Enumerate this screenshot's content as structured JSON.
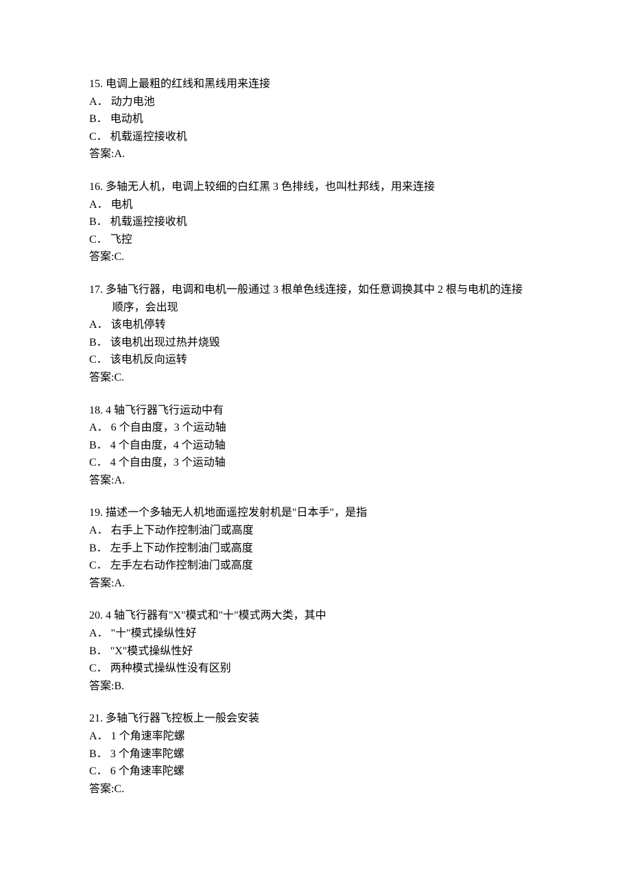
{
  "questions": [
    {
      "number": "15.",
      "text": "电调上最粗的红线和黑线用来连接",
      "text_cont": "",
      "options": [
        {
          "label": "A．",
          "text": "动力电池"
        },
        {
          "label": "B．",
          "text": "电动机"
        },
        {
          "label": "C．",
          "text": "机载遥控接收机"
        }
      ],
      "answer": "答案:A."
    },
    {
      "number": "16.",
      "text": "多轴无人机，电调上较细的白红黑 3 色排线，也叫杜邦线，用来连接",
      "text_cont": "",
      "options": [
        {
          "label": "A．",
          "text": "电机"
        },
        {
          "label": "B．",
          "text": "机载遥控接收机"
        },
        {
          "label": "C．",
          "text": "飞控"
        }
      ],
      "answer": "答案:C."
    },
    {
      "number": "17.",
      "text": "多轴飞行器，电调和电机一般通过 3 根单色线连接，如任意调换其中 2 根与电机的连接",
      "text_cont": "顺序，会出现",
      "options": [
        {
          "label": "A．",
          "text": "该电机停转"
        },
        {
          "label": "B．",
          "text": "该电机出现过热并烧毁"
        },
        {
          "label": "C．",
          "text": "该电机反向运转"
        }
      ],
      "answer": "答案:C."
    },
    {
      "number": "18.",
      "text": "4 轴飞行器飞行运动中有",
      "text_cont": "",
      "options": [
        {
          "label": "A．",
          "text": "6 个自由度，3 个运动轴"
        },
        {
          "label": "B．",
          "text": "4 个自由度，4 个运动轴"
        },
        {
          "label": "C．",
          "text": "4 个自由度，3 个运动轴"
        }
      ],
      "answer": "答案:A."
    },
    {
      "number": "19.",
      "text": "描述一个多轴无人机地面遥控发射机是\"日本手\"，是指",
      "text_cont": "",
      "options": [
        {
          "label": "A．",
          "text": "右手上下动作控制油门或高度"
        },
        {
          "label": "B．",
          "text": "左手上下动作控制油门或高度"
        },
        {
          "label": "C．",
          "text": "左手左右动作控制油门或高度"
        }
      ],
      "answer": "答案:A."
    },
    {
      "number": "20.",
      "text": "4 轴飞行器有\"X\"模式和\"十\"模式两大类，其中",
      "text_cont": "",
      "options": [
        {
          "label": "A．",
          "text": "\"十\"模式操纵性好"
        },
        {
          "label": "B．",
          "text": "\"X\"模式操纵性好"
        },
        {
          "label": "C．",
          "text": "两种模式操纵性没有区别"
        }
      ],
      "answer": "答案:B."
    },
    {
      "number": "21.",
      "text": "多轴飞行器飞控板上一般会安装",
      "text_cont": "",
      "options": [
        {
          "label": "A．",
          "text": "1 个角速率陀螺"
        },
        {
          "label": "B．",
          "text": "3 个角速率陀螺"
        },
        {
          "label": "C．",
          "text": "6 个角速率陀螺"
        }
      ],
      "answer": "答案:C."
    }
  ]
}
